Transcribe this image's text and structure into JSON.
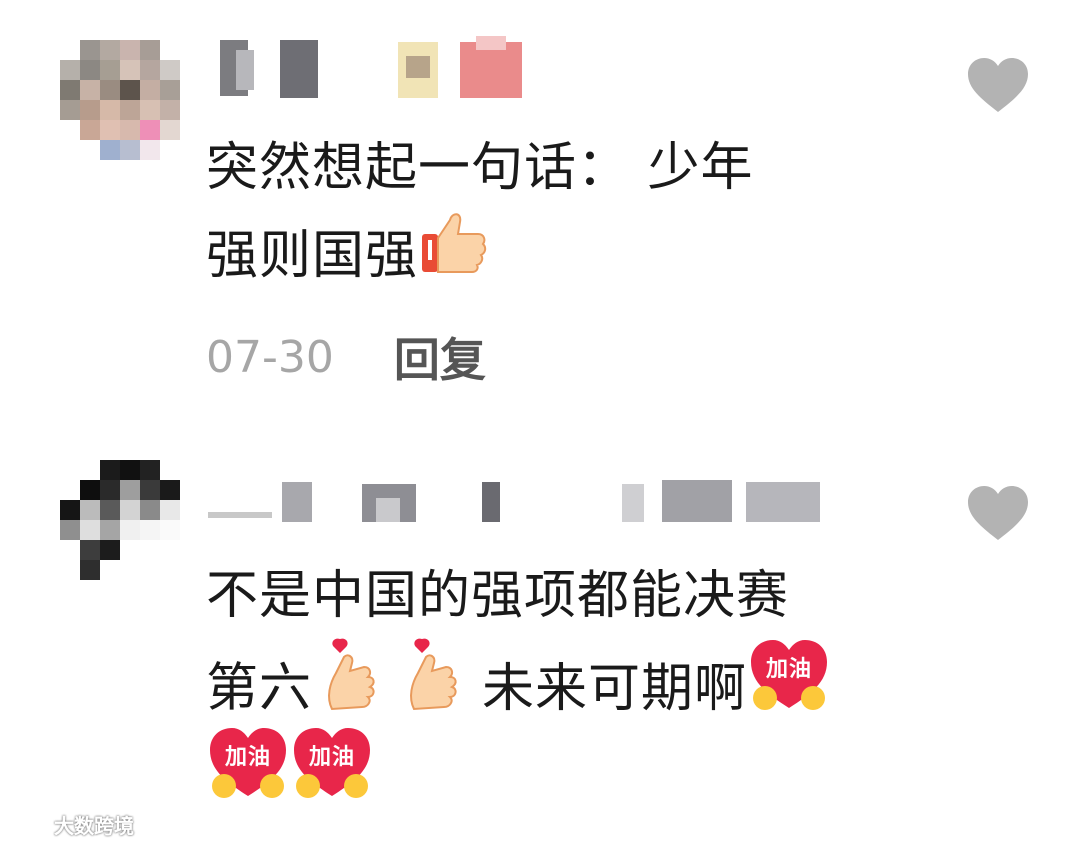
{
  "comments": [
    {
      "lines": [
        "突然想起一句话： 少年",
        "强则国强"
      ],
      "date": "07-30",
      "reply_label": "回复",
      "emoji": [
        "thumbs-up"
      ]
    },
    {
      "lines": [
        "不是中国的强项都能决赛",
        "第六",
        "未来可期啊"
      ],
      "emoji": [
        "finger-heart",
        "finger-heart",
        "jiayou-heart",
        "jiayou-heart",
        "jiayou-heart"
      ]
    }
  ],
  "sticker_text": "加油",
  "watermark": "大数跨境",
  "colors": {
    "text": "#1a1a1a",
    "date": "#a6a6a6",
    "reply": "#555555",
    "like": "#b3b3b3",
    "sticker": "#e8264a"
  }
}
